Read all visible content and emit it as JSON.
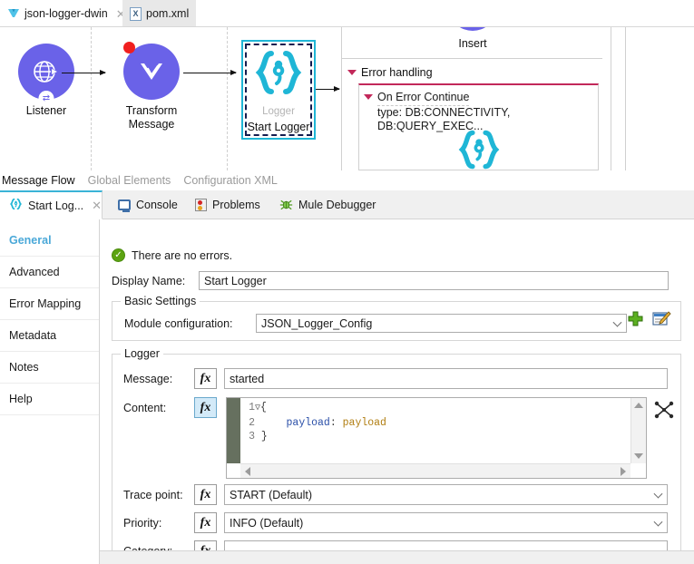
{
  "editor_tabs": [
    {
      "label": "json-logger-dwin",
      "icon": "mule-bird-icon",
      "active": true,
      "closable": true
    },
    {
      "label": "pom.xml",
      "icon": "xml-file-icon",
      "active": false,
      "closable": false
    }
  ],
  "canvas": {
    "nodes": [
      {
        "name": "Listener",
        "icon": "http-listener-globe-icon",
        "has_error_badge": false
      },
      {
        "name": "Transform Message",
        "icon": "transform-message-icon",
        "has_error_badge": true
      }
    ],
    "selected_node": {
      "placeholder": "Logger",
      "name": "Start Logger",
      "icon": "json-logger-braces-icon"
    },
    "error_handling": {
      "insert_label": "Insert",
      "title": "Error handling",
      "scope_title": "On Error Continue",
      "scope_subtitle": "type: DB:CONNECTIVITY, DB:QUERY_EXEC...",
      "scope_icon": "json-logger-braces-icon"
    }
  },
  "view_tabs": [
    {
      "label": "Message Flow",
      "active": true
    },
    {
      "label": "Global Elements",
      "active": false
    },
    {
      "label": "Configuration XML",
      "active": false
    }
  ],
  "panel_tabs": [
    {
      "label": "Start Log...",
      "icon": "json-logger-braces-icon",
      "active": true,
      "closable": true
    },
    {
      "label": "Console",
      "icon": "console-icon",
      "active": false,
      "closable": false
    },
    {
      "label": "Problems",
      "icon": "problems-icon",
      "active": false,
      "closable": false
    },
    {
      "label": "Mule Debugger",
      "icon": "mule-debugger-bug-icon",
      "active": false,
      "closable": false
    }
  ],
  "properties": {
    "sidebar": [
      {
        "label": "General",
        "active": true
      },
      {
        "label": "Advanced",
        "active": false
      },
      {
        "label": "Error Mapping",
        "active": false
      },
      {
        "label": "Metadata",
        "active": false
      },
      {
        "label": "Notes",
        "active": false
      },
      {
        "label": "Help",
        "active": false
      }
    ],
    "status_message": "There are no errors.",
    "status_icon": "green-check-icon",
    "display_name": {
      "label": "Display Name:",
      "value": "Start Logger"
    },
    "basic_settings": {
      "title": "Basic Settings",
      "module_config": {
        "label": "Module configuration:",
        "value": "JSON_Logger_Config",
        "add_button": "add-config-button",
        "edit_button": "edit-config-button"
      }
    },
    "logger": {
      "title": "Logger",
      "message": {
        "label": "Message:",
        "value": "started",
        "fx": "fx",
        "fx_active": false
      },
      "content": {
        "label": "Content:",
        "fx": "fx",
        "fx_active": true,
        "code_lines": [
          {
            "num": "1",
            "fold": true,
            "text": "{"
          },
          {
            "num": "2",
            "fold": false,
            "key": "payload",
            "colon": ": ",
            "value": "payload"
          },
          {
            "num": "3",
            "fold": false,
            "text": "}"
          }
        ],
        "dw_icon": "dataweave-transform-icon"
      },
      "trace_point": {
        "label": "Trace point:",
        "value": "START (Default)",
        "fx": "fx",
        "fx_active": false
      },
      "priority": {
        "label": "Priority:",
        "value": "INFO (Default)",
        "fx": "fx",
        "fx_active": false
      },
      "category": {
        "label": "Category:",
        "value": "",
        "fx": "fx",
        "fx_active": false
      }
    }
  },
  "colors": {
    "mule_purple": "#6a62e8",
    "json_logger_cyan": "#1fb6d6",
    "selection_border": "#1fb6d6",
    "error_red": "#c2285a",
    "error_badge": "#f01f1f",
    "active_tab_accent": "#3ab3d6",
    "sidebar_active": "#4aa8d8",
    "success_green": "#5ca312"
  }
}
